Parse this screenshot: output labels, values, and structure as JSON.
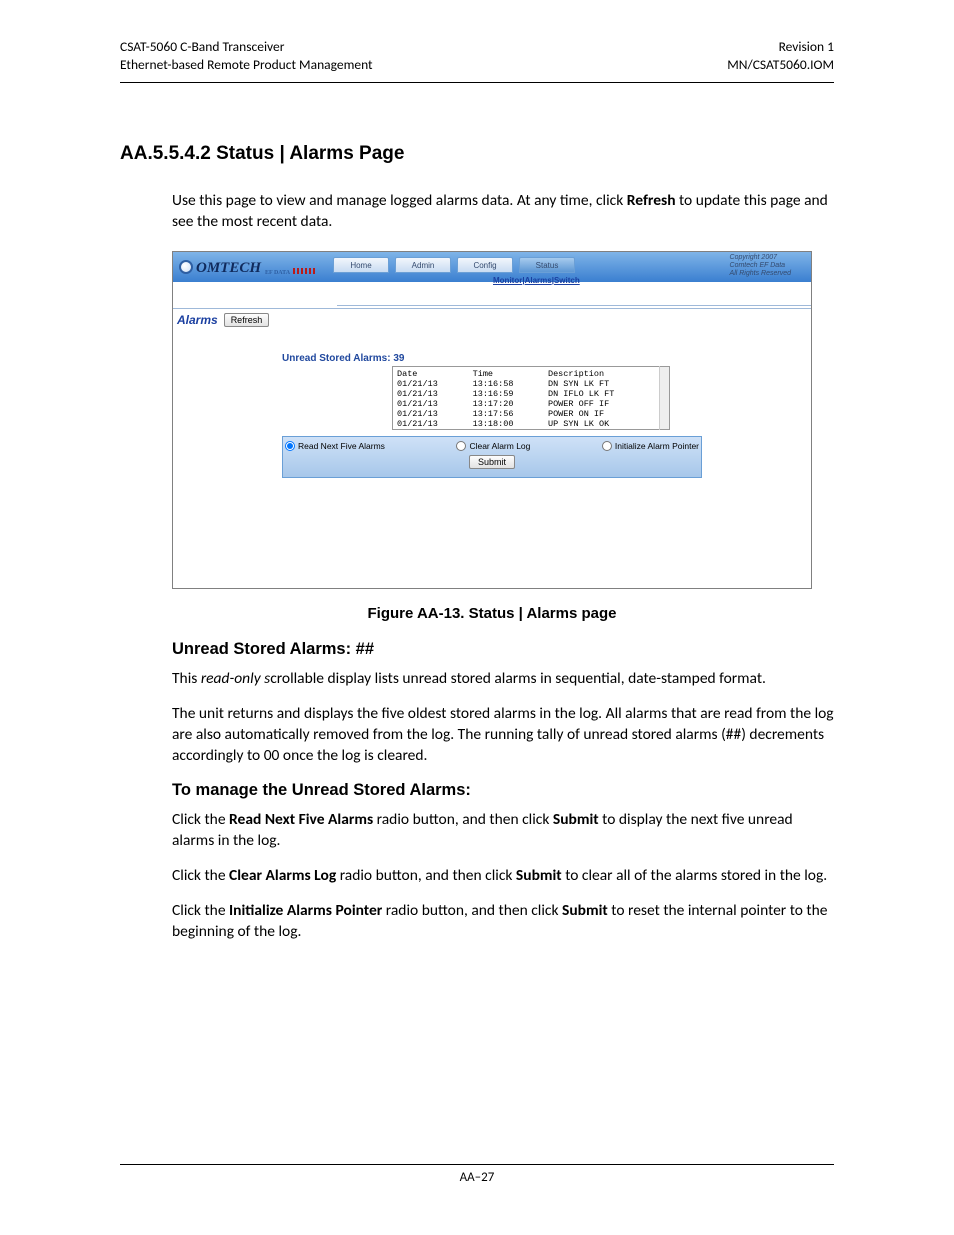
{
  "header": {
    "left1": "CSAT-5060 C-Band Transceiver",
    "left2": "Ethernet-based Remote Product Management",
    "right1": "Revision 1",
    "right2": "MN/CSAT5060.IOM"
  },
  "section_heading": "AA.5.5.4.2   Status | Alarms Page",
  "intro_pre": "Use this page to view and manage logged alarms data. At any time, click ",
  "intro_bold": "Refresh",
  "intro_post": " to update this page and see the most recent data.",
  "figure": {
    "logo_text": "OMTECH",
    "logo_sub": "EF DATA",
    "tabs": [
      "Home",
      "Admin",
      "Config",
      "Status"
    ],
    "active_tab_index": 3,
    "subnav": {
      "a": "Monitor",
      "b": "Alarms",
      "c": "Switch",
      "sep": "|"
    },
    "copyright": [
      "Copyright 2007",
      "Comtech EF Data",
      "All Rights Reserved"
    ],
    "alarms_label": "Alarms",
    "refresh_btn": "Refresh",
    "panel_title": "Unread Stored Alarms: 39",
    "log_headers": [
      "Date",
      "Time",
      "Description"
    ],
    "log_rows": [
      {
        "date": "01/21/13",
        "time": "13:16:58",
        "desc": "DN SYN LK  FT"
      },
      {
        "date": "01/21/13",
        "time": "13:16:59",
        "desc": "DN IFLO LK FT"
      },
      {
        "date": "01/21/13",
        "time": "13:17:20",
        "desc": "POWER OFF  IF"
      },
      {
        "date": "01/21/13",
        "time": "13:17:56",
        "desc": "POWER ON   IF"
      },
      {
        "date": "01/21/13",
        "time": "13:18:00",
        "desc": "UP SYN LK  OK"
      }
    ],
    "radios": {
      "read_next": "Read Next Five Alarms",
      "clear_log": "Clear Alarm Log",
      "init_ptr": "Initialize Alarm Pointer"
    },
    "submit": "Submit"
  },
  "figure_caption": "Figure AA-13. Status | Alarms page",
  "h3_unread": "Unread Stored Alarms: ##",
  "unread_p1_pre": "This ",
  "unread_p1_ital": "read-only s",
  "unread_p1_post": "crollable display lists unread stored alarms in sequential, date-stamped format.",
  "unread_p2": "The unit returns and displays the five oldest stored alarms in the log. All alarms that are read from the log are also automatically removed from the log. The running tally of unread stored alarms (##) decrements accordingly to 00 once the log is cleared.",
  "h3_manage": "To manage the Unread Stored Alarms:",
  "manage_p1_pre": "Click the ",
  "manage_p1_b1": "Read Next Five Alarms",
  "manage_p1_mid": " radio button, and then click ",
  "manage_p1_b2": "Submit",
  "manage_p1_post": " to display the next five unread alarms in the log.",
  "manage_p2_pre": "Click the ",
  "manage_p2_b1": "Clear Alarms Log",
  "manage_p2_mid": " radio button, and then click ",
  "manage_p2_b2": "Submit",
  "manage_p2_post": " to clear all of the alarms stored in the log.",
  "manage_p3_pre": "Click the ",
  "manage_p3_b1": "Initialize Alarms Pointer",
  "manage_p3_mid": " radio button, and then click ",
  "manage_p3_b2": "Submit",
  "manage_p3_post": " to reset the internal pointer to the beginning of the log.",
  "footer": "AA–27"
}
